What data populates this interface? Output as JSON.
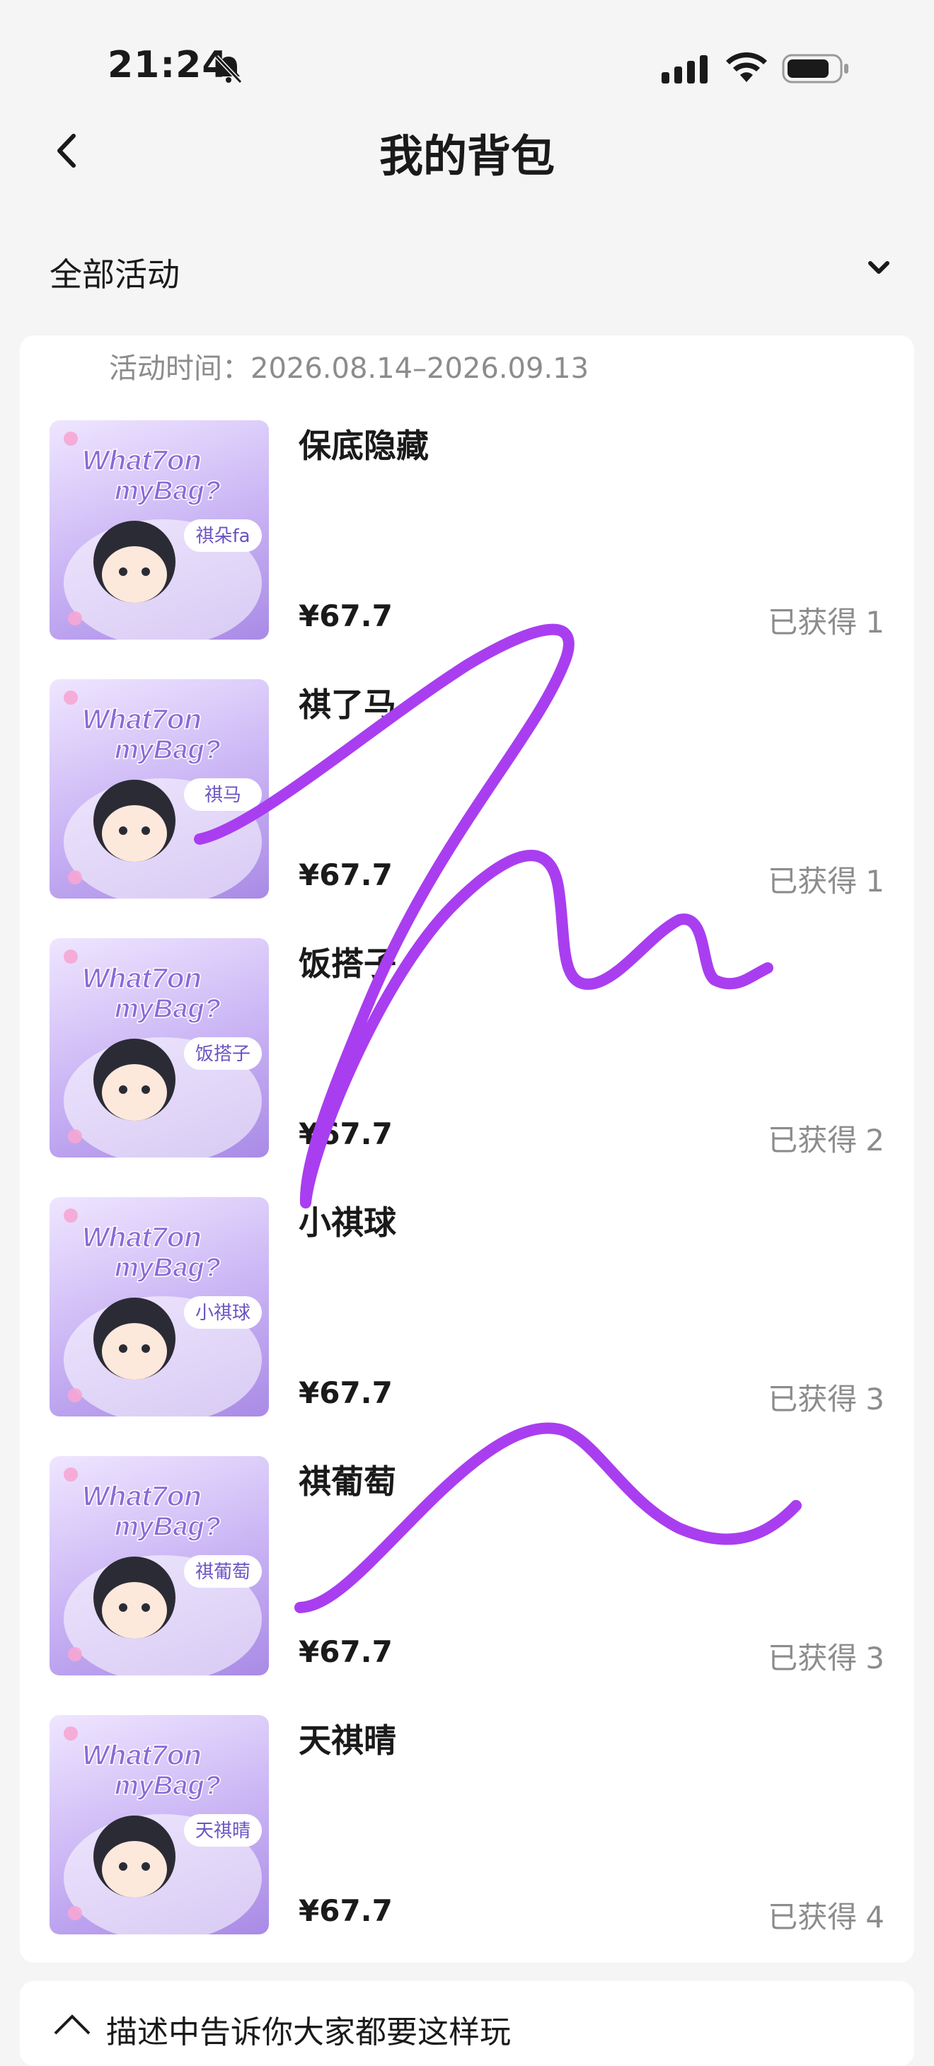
{
  "status_bar": {
    "time": "21:24"
  },
  "header": {
    "title": "我的背包"
  },
  "filter": {
    "label": "全部活动"
  },
  "activity": {
    "time_label": "活动时间：2026.08.14–2026.09.13"
  },
  "items": [
    {
      "name": "保底隐藏",
      "price": "¥67.7",
      "owned_label": "已获得",
      "owned_count": "1",
      "thumb_tag": "祺朵fa",
      "thumb_title_1": "What7on",
      "thumb_title_2": "myBag?"
    },
    {
      "name": "祺了马",
      "price": "¥67.7",
      "owned_label": "已获得",
      "owned_count": "1",
      "thumb_tag": "祺马",
      "thumb_title_1": "What7on",
      "thumb_title_2": "myBag?"
    },
    {
      "name": "饭搭子",
      "price": "¥67.7",
      "owned_label": "已获得",
      "owned_count": "2",
      "thumb_tag": "饭搭子",
      "thumb_title_1": "What7on",
      "thumb_title_2": "myBag?"
    },
    {
      "name": "小祺球",
      "price": "¥67.7",
      "owned_label": "已获得",
      "owned_count": "3",
      "thumb_tag": "小祺球",
      "thumb_title_1": "What7on",
      "thumb_title_2": "myBag?"
    },
    {
      "name": "祺葡萄",
      "price": "¥67.7",
      "owned_label": "已获得",
      "owned_count": "3",
      "thumb_tag": "祺葡萄",
      "thumb_title_1": "What7on",
      "thumb_title_2": "myBag?"
    },
    {
      "name": "天祺晴",
      "price": "¥67.7",
      "owned_label": "已获得",
      "owned_count": "4",
      "thumb_tag": "天祺晴",
      "thumb_title_1": "What7on",
      "thumb_title_2": "myBag?"
    }
  ],
  "bottom": {
    "text": "描述中告诉你大家都要这样玩"
  },
  "colors": {
    "accent": "#a93ef0",
    "background": "#f5f5f5",
    "muted": "#8c8c8c"
  },
  "icons": [
    "bell-muted-icon",
    "signal-icon",
    "wifi-icon",
    "battery-icon",
    "back-arrow-icon",
    "chevron-down-icon",
    "info-icon"
  ]
}
